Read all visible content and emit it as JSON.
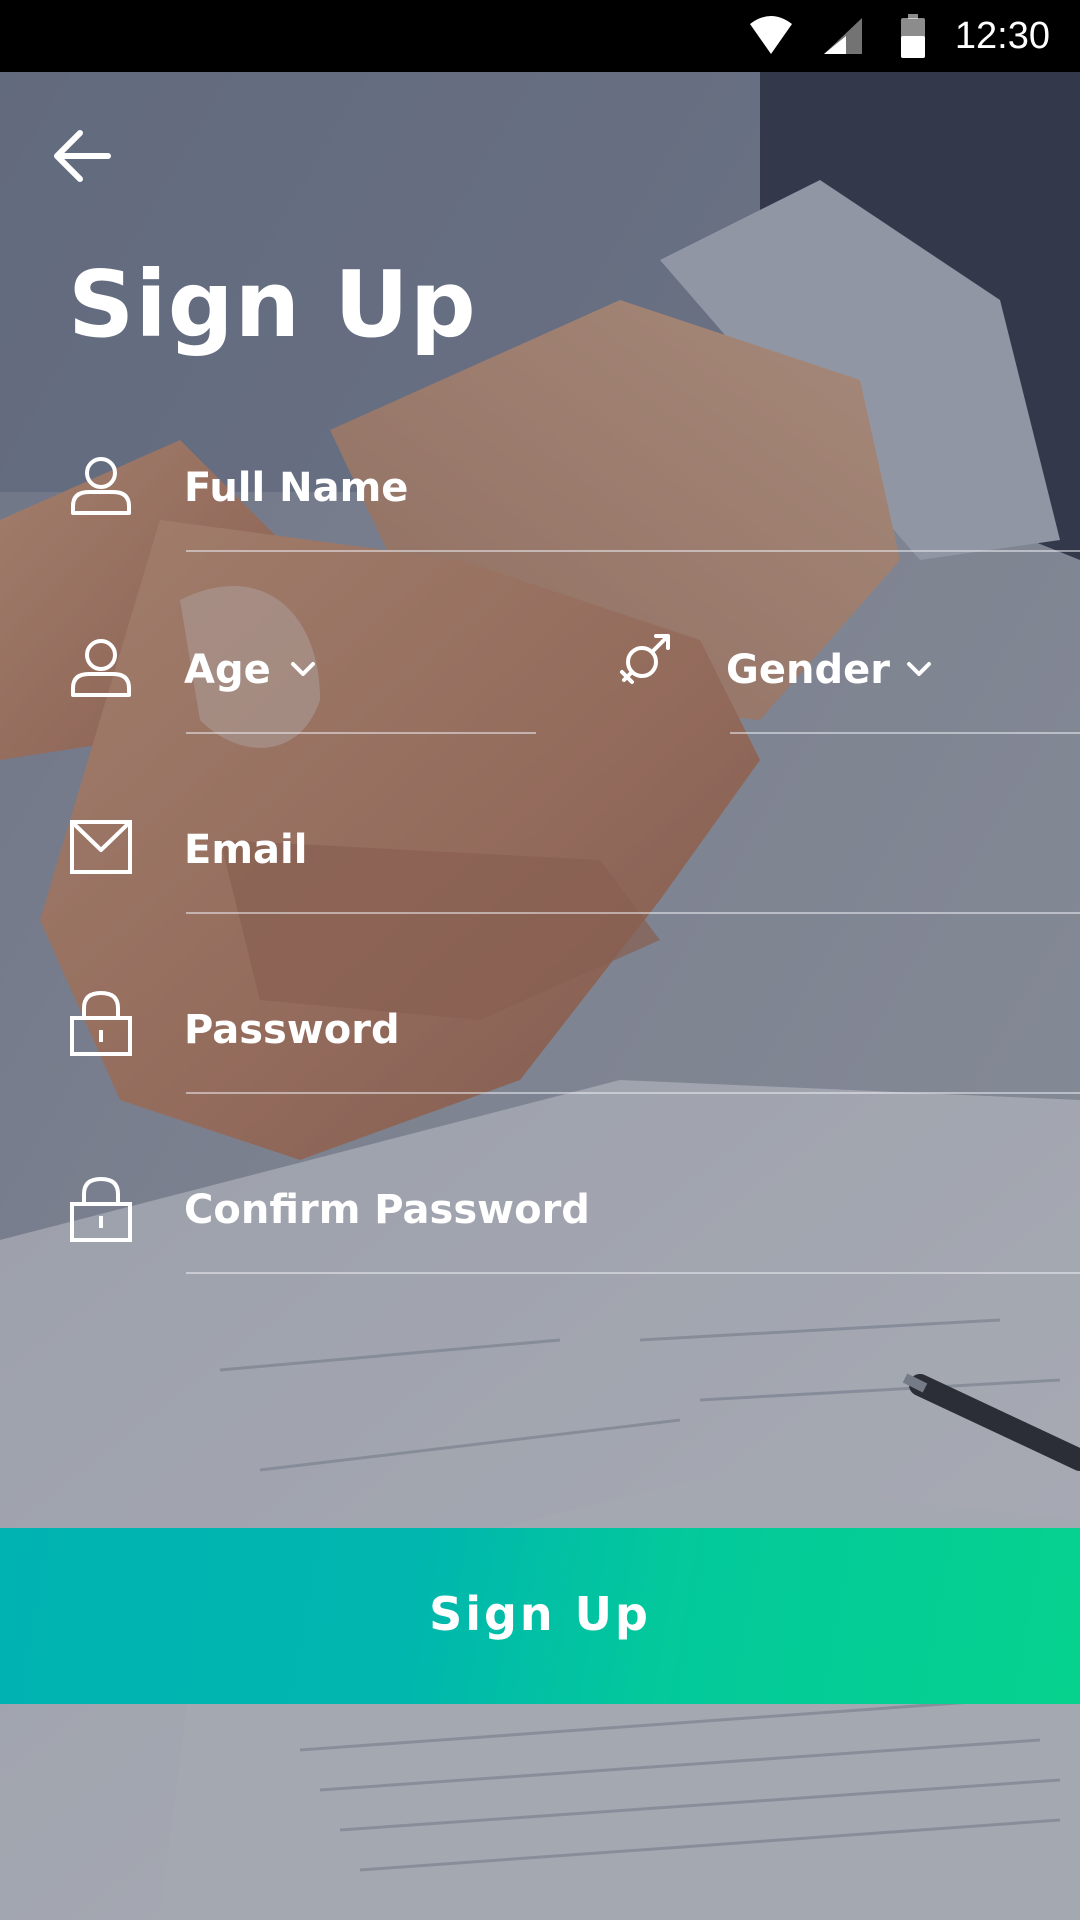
{
  "status_bar": {
    "time": "12:30",
    "icons": [
      "wifi-icon",
      "cellular-signal-icon",
      "battery-icon"
    ]
  },
  "header": {
    "back_icon": "arrow-left-icon",
    "title": "Sign Up"
  },
  "form": {
    "full_name": {
      "label": "Full Name",
      "icon": "person-icon"
    },
    "age": {
      "label": "Age",
      "icon": "person-icon",
      "dropdown": "chevron-down-icon"
    },
    "gender": {
      "label": "Gender",
      "icon": "gender-icon",
      "dropdown": "chevron-down-icon"
    },
    "email": {
      "label": "Email",
      "icon": "envelope-icon"
    },
    "password": {
      "label": "Password",
      "icon": "lock-icon"
    },
    "confirm_password": {
      "label": "Confirm Password",
      "icon": "lock-icon"
    }
  },
  "actions": {
    "signup_label": "Sign Up"
  },
  "colors": {
    "button_gradient_start": "#00b3b3",
    "button_gradient_end": "#06d28e",
    "text": "#ffffff",
    "status_bar": "#000000"
  }
}
